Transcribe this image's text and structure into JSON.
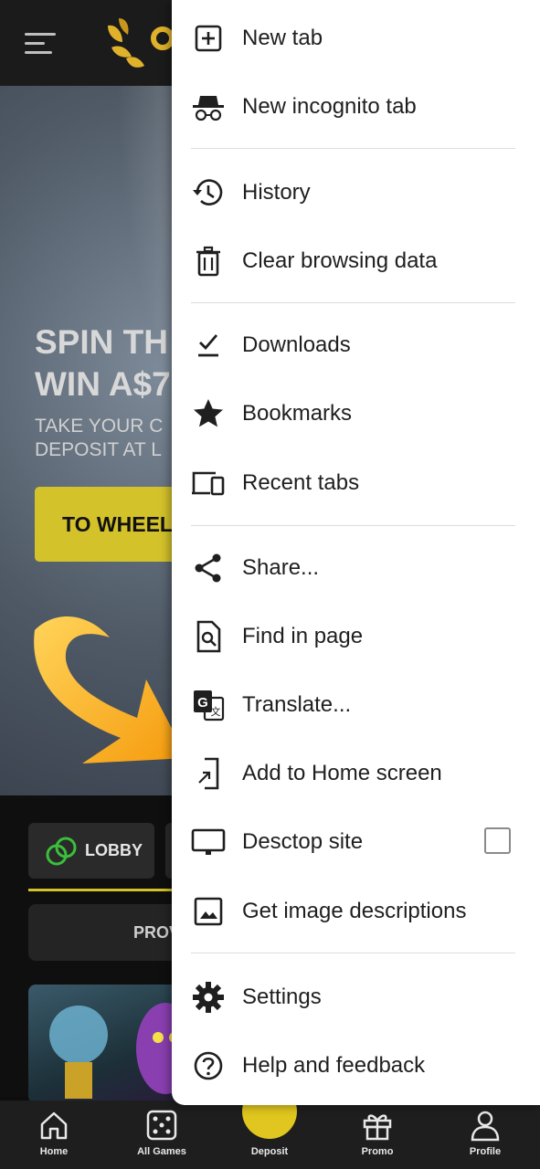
{
  "background": {
    "hero": {
      "title": "SPIN TH\nWIN A$7",
      "subtitle": "TAKE YOUR C\nDEPOSIT AT L",
      "button_label": "TO WHEEL"
    },
    "lobby_label": "LOBBY",
    "providers_label": "PROV",
    "bottom_nav": [
      {
        "label": "Home",
        "icon": "home-icon"
      },
      {
        "label": "All Games",
        "icon": "dice-icon"
      },
      {
        "label": "Deposit",
        "icon": "wallet-icon"
      },
      {
        "label": "Promo",
        "icon": "gift-icon"
      },
      {
        "label": "Profile",
        "icon": "user-icon"
      }
    ]
  },
  "menu": {
    "items": [
      {
        "label": "New tab",
        "icon": "new-tab-icon"
      },
      {
        "label": "New incognito tab",
        "icon": "incognito-icon"
      },
      {
        "label": "History",
        "icon": "history-icon"
      },
      {
        "label": "Clear browsing data",
        "icon": "trash-icon"
      },
      {
        "label": "Downloads",
        "icon": "download-icon"
      },
      {
        "label": "Bookmarks",
        "icon": "star-icon"
      },
      {
        "label": "Recent tabs",
        "icon": "devices-icon"
      },
      {
        "label": "Share...",
        "icon": "share-icon"
      },
      {
        "label": "Find in page",
        "icon": "find-in-page-icon"
      },
      {
        "label": "Translate...",
        "icon": "translate-icon"
      },
      {
        "label": "Add to Home screen",
        "icon": "add-to-home-icon"
      },
      {
        "label": "Desctop site",
        "icon": "monitor-icon",
        "checked": false
      },
      {
        "label": "Get image descriptions",
        "icon": "image-icon"
      },
      {
        "label": "Settings",
        "icon": "gear-icon"
      },
      {
        "label": "Help and feedback",
        "icon": "help-icon"
      }
    ]
  },
  "colors": {
    "accent_yellow": "#d4c22a",
    "arrow_orange": "#f5a623",
    "menu_bg": "#ffffff",
    "menu_text": "#1f1f1f"
  }
}
